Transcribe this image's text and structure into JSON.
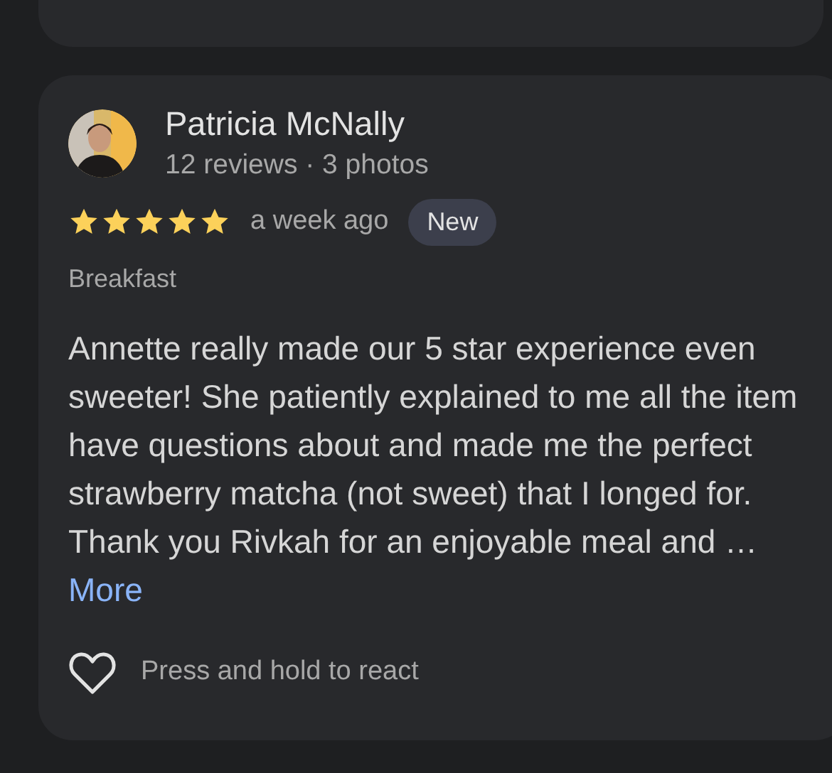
{
  "review": {
    "author": "Patricia McNally",
    "author_meta": "12 reviews · 3 photos",
    "stars": 5,
    "time": "a week ago",
    "badge": "New",
    "category": "Breakfast",
    "body": "Annette really made our 5 star experience even\nsweeter! She patiently explained to me all the item\nhave questions about and made me the perfect\nstrawberry matcha (not sweet) that I longed for.\nThank you Rivkah for an enjoyable meal and …",
    "more_link": "More",
    "react_hint": "Press and hold to react"
  }
}
